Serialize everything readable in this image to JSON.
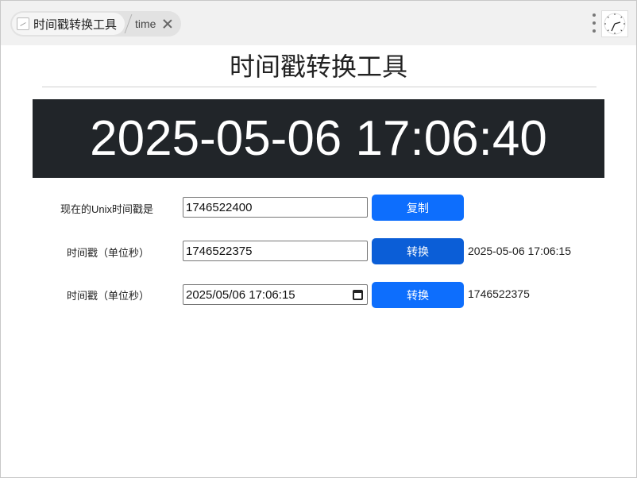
{
  "tabbar": {
    "active_tab_title": "时间戳转换工具",
    "second_tab_title": "time"
  },
  "page": {
    "title": "时间戳转换工具",
    "current_datetime": "2025-05-06 17:06:40"
  },
  "rows": [
    {
      "label": "现在的Unix时间戳是",
      "input_value": "1746522400",
      "button_label": "复制",
      "result": ""
    },
    {
      "label": "时间戳（单位秒）",
      "input_value": "1746522375",
      "button_label": "转换",
      "result": "2025-05-06 17:06:15"
    },
    {
      "label": "时间戳（单位秒）",
      "input_value": "2025/05/06 17:06:15",
      "button_label": "转换",
      "result": "1746522375"
    }
  ],
  "colors": {
    "primary": "#0d6efd",
    "clock_bg": "#212529"
  }
}
